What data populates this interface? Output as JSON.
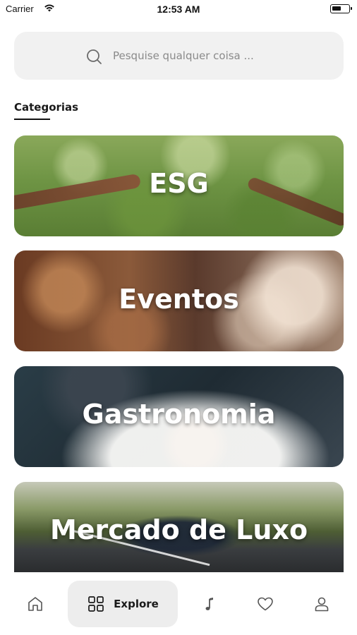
{
  "status_bar": {
    "carrier": "Carrier",
    "time": "12:53 AM"
  },
  "search": {
    "placeholder": "Pesquise qualquer coisa ..."
  },
  "section": {
    "title": "Categorias"
  },
  "categories": [
    {
      "label": "ESG"
    },
    {
      "label": "Eventos"
    },
    {
      "label": "Gastronomia"
    },
    {
      "label": "Mercado de Luxo"
    }
  ],
  "bottom_nav": {
    "items": [
      {
        "icon": "home-icon"
      },
      {
        "icon": "grid-icon",
        "label": "Explore",
        "active": true
      },
      {
        "icon": "music-note-icon"
      },
      {
        "icon": "heart-icon"
      },
      {
        "icon": "user-icon"
      }
    ]
  },
  "colors": {
    "background": "#ffffff",
    "search_bg": "#f1f1f1",
    "active_nav_bg": "#ededed",
    "text": "#1a1a1a",
    "card_text": "#ffffff"
  }
}
